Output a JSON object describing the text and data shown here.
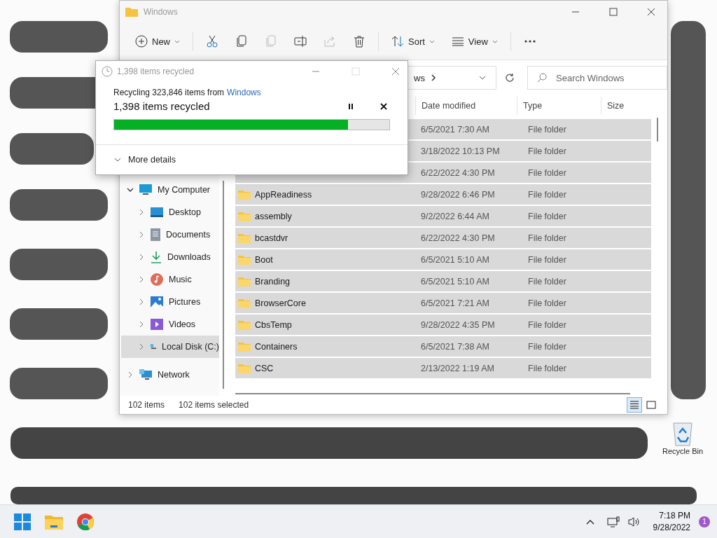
{
  "explorer": {
    "title": "Windows",
    "toolbar": [
      {
        "kind": "new",
        "label": "New",
        "disabled": false
      },
      {
        "kind": "cut",
        "disabled": false
      },
      {
        "kind": "copy",
        "disabled": false
      },
      {
        "kind": "paste",
        "disabled": true
      },
      {
        "kind": "rename",
        "disabled": false
      },
      {
        "kind": "share",
        "disabled": true
      },
      {
        "kind": "delete",
        "disabled": false
      },
      {
        "kind": "sort",
        "label": "Sort",
        "disabled": false
      },
      {
        "kind": "view",
        "label": "View",
        "disabled": false
      },
      {
        "kind": "more",
        "disabled": false
      }
    ],
    "address": "ws",
    "search": {
      "placeholder": "Search Windows"
    },
    "columns": [
      "Date modified",
      "Type",
      "Size"
    ],
    "sidebar": [
      {
        "label": "My Computer",
        "kind": "computer",
        "expanded": true,
        "selected": false,
        "children": [
          {
            "label": "Desktop",
            "kind": "desktop",
            "expanded": false,
            "selected": false
          },
          {
            "label": "Documents",
            "kind": "documents",
            "expanded": false,
            "selected": false
          },
          {
            "label": "Downloads",
            "kind": "downloads",
            "expanded": false,
            "selected": false
          },
          {
            "label": "Music",
            "kind": "music",
            "expanded": false,
            "selected": false
          },
          {
            "label": "Pictures",
            "kind": "pictures",
            "expanded": false,
            "selected": false
          },
          {
            "label": "Videos",
            "kind": "videos",
            "expanded": false,
            "selected": false
          },
          {
            "label": "Local Disk (C:)",
            "kind": "disk",
            "expanded": false,
            "selected": true
          }
        ]
      },
      {
        "label": "Network",
        "kind": "network",
        "expanded": false,
        "selected": false
      }
    ],
    "rows": [
      {
        "date": "6/5/2021 7:30 AM",
        "type": "File folder",
        "selected": true
      },
      {
        "date": "3/18/2022 10:13 PM",
        "type": "File folder",
        "selected": true
      },
      {
        "date": "6/22/2022 4:30 PM",
        "type": "File folder",
        "selected": true
      },
      {
        "name": "AppReadiness",
        "date": "9/28/2022 6:46 PM",
        "type": "File folder",
        "selected": true
      },
      {
        "name": "assembly",
        "date": "9/2/2022 6:44 AM",
        "type": "File folder",
        "selected": true
      },
      {
        "name": "bcastdvr",
        "date": "6/22/2022 4:30 PM",
        "type": "File folder",
        "selected": true
      },
      {
        "name": "Boot",
        "date": "6/5/2021 5:10 AM",
        "type": "File folder",
        "selected": true
      },
      {
        "name": "Branding",
        "date": "6/5/2021 5:10 AM",
        "type": "File folder",
        "selected": true
      },
      {
        "name": "BrowserCore",
        "date": "6/5/2021 7:21 AM",
        "type": "File folder",
        "selected": true
      },
      {
        "name": "CbsTemp",
        "date": "9/28/2022 4:35 PM",
        "type": "File folder",
        "selected": true
      },
      {
        "name": "Containers",
        "date": "6/5/2021 7:38 AM",
        "type": "File folder",
        "selected": true
      },
      {
        "name": "CSC",
        "date": "2/13/2022 1:19 AM",
        "type": "File folder",
        "selected": true
      }
    ],
    "status": {
      "count": "102 items",
      "selection": "102 items selected"
    },
    "views": [
      {
        "kind": "details",
        "selected": true
      },
      {
        "kind": "tiles",
        "selected": false
      }
    ]
  },
  "dialog": {
    "title": "1,398 items recycled",
    "source_prefix": "Recycling 323,846 items from",
    "source_link": "Windows",
    "progress_text": "1,398 items recycled",
    "level": 0.85,
    "details_label": "More details",
    "details_expanded": false
  },
  "desktop_icons": [
    {
      "label": "Recycle Bin"
    }
  ],
  "taskbar": {
    "apps": [
      {
        "kind": "start"
      },
      {
        "kind": "explorer"
      },
      {
        "kind": "chrome"
      }
    ],
    "time": "7:18 PM",
    "date": "9/28/2022",
    "badge": "1"
  }
}
